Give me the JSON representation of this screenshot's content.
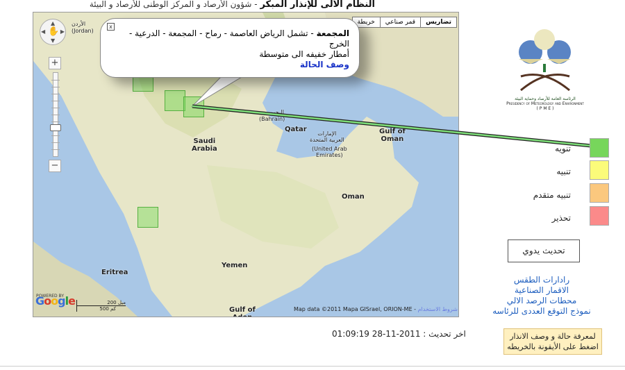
{
  "header": {
    "title_bold": "النظام الالى للإنذار المبكر",
    "title_rest": " - شؤون الأرصاد و المركز الوطنى للأرصاد و البيئة"
  },
  "map": {
    "map_types": [
      "تضاريس",
      "قمر صناعي",
      "خريطة"
    ],
    "labels": {
      "jordan_ar": "الأردن",
      "jordan_en": "(Jordan)",
      "saudi": "Saudi\nArabia",
      "bahrain_ar": "البحرين",
      "bahrain_en": "(Bahrain)",
      "qatar": "Qatar",
      "uae_ar": "الإمارات\nالعربية المتحدة",
      "uae_en": "(United Arab\nEmirates)",
      "gulf_oman": "Gulf of\nOman",
      "oman": "Oman",
      "yemen": "Yemen",
      "eritrea": "Eritrea",
      "gulf_aden": "Gulf of\nAden"
    },
    "scale_miles": "200 ميل",
    "scale_km": "500 كم",
    "powered_by": "POWERED BY",
    "google": "Google",
    "credit": "Map data ©2011 Mapa GISrael, ORION-ME - ",
    "terms": "شروط الاستخدام"
  },
  "bubble": {
    "close": "x",
    "region": "المجمعة",
    "areas": " - تشمل الرياض العاصمة - رماح - المجمعة - الدرعية - الخرج",
    "forecast": "أمطار خفيفه الى متوسطة",
    "link": "وصف الحالة"
  },
  "legend": {
    "items": [
      {
        "label": "تنويه",
        "color": "#77d65b"
      },
      {
        "label": "تنبيه",
        "color": "#fbfb7a"
      },
      {
        "label": "تنبيه متقدم",
        "color": "#fbc87e"
      },
      {
        "label": "تحذير",
        "color": "#fb8a8a"
      }
    ]
  },
  "logo": {
    "caption_ar": "الرئاسة العامة للأرصاد وحماية البيئة",
    "caption_en": "Presidency of Meteorology and Environment",
    "abbr": "( P M E )"
  },
  "manual_update": "تحديث يدوي",
  "links": [
    "رادارات الطقس",
    "الاقمار الصناعية",
    "محطات الرصد الالي",
    "نموذج التوقع العددى للرئاسه"
  ],
  "last_update": "01:09:19 28-11-2011 : اخر تحديث",
  "info_box": "لمعرفة حالة و وصف الانذار\nاضغط على الأيقونة بالخريطه"
}
